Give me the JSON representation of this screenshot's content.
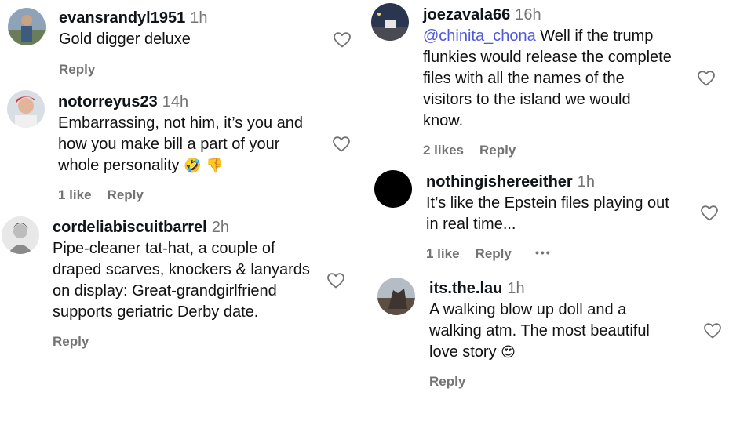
{
  "left_column": [
    {
      "username": "evansrandyl1951",
      "time": "1h",
      "lines": [
        "Gold digger deluxe"
      ],
      "likes": "",
      "reply": "Reply"
    },
    {
      "username": "notorreyus23",
      "time": "14h",
      "lines": [
        "Embarrassing, not him, it’s you and",
        "how you make bill a part of your",
        "whole personality"
      ],
      "emoji_after": [
        "🤣",
        "👎"
      ],
      "likes": "1 like",
      "reply": "Reply"
    },
    {
      "username": "cordeliabiscuitbarrel",
      "time": "2h",
      "lines": [
        "Pipe-cleaner tat-hat, a couple of",
        "draped scarves, knockers & lanyards",
        "on display: Great-grandgirlfriend",
        "supports geriatric Derby date."
      ],
      "likes": "",
      "reply": "Reply"
    }
  ],
  "right_column": [
    {
      "username": "joezavala66",
      "time": "16h",
      "mention": "@chinita_chona",
      "lines": [
        " Well if the trump",
        "flunkies would release the complete",
        "files with all the names of the",
        "visitors to the island we would",
        "know."
      ],
      "likes": "2 likes",
      "reply": "Reply"
    },
    {
      "username": "nothingishereeither",
      "time": "1h",
      "lines": [
        "It’s like the Epstein files playing out",
        "in real time..."
      ],
      "likes": "1 like",
      "reply": "Reply",
      "more": "•••"
    },
    {
      "username": "its.the.lau",
      "time": "1h",
      "lines": [
        "A walking blow up doll and a",
        "walking atm. The most beautiful",
        "love story"
      ],
      "emoji_after": [
        "😍"
      ],
      "likes": "",
      "reply": "Reply"
    }
  ],
  "icons": {
    "like": "heart-outline-icon",
    "more": "more-options-icon"
  },
  "colors": {
    "text": "#0f1419",
    "muted": "#737373",
    "mention": "#4f58d8"
  }
}
